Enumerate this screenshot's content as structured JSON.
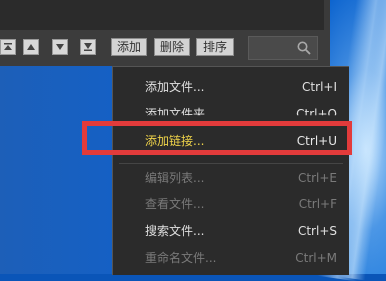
{
  "toolbar": {
    "buttons": [
      {
        "name": "move-top-icon"
      },
      {
        "name": "move-up-icon"
      },
      {
        "name": "move-down-icon"
      },
      {
        "name": "move-bottom-icon"
      }
    ],
    "add_label": "添加",
    "delete_label": "删除",
    "sort_label": "排序",
    "search_icon": "search-icon"
  },
  "menu": {
    "items": [
      {
        "label": "添加文件...",
        "shortcut": "Ctrl+I",
        "state": "enabled"
      },
      {
        "label": "添加文件夹",
        "shortcut": "Ctrl+O",
        "state": "enabled"
      },
      {
        "label": "添加链接...",
        "shortcut": "Ctrl+U",
        "state": "highlighted"
      },
      {
        "label": "编辑列表...",
        "shortcut": "Ctrl+E",
        "state": "disabled"
      },
      {
        "label": "查看文件...",
        "shortcut": "Ctrl+F",
        "state": "disabled"
      },
      {
        "label": "搜索文件...",
        "shortcut": "Ctrl+S",
        "state": "enabled"
      },
      {
        "label": "重命名文件...",
        "shortcut": "Ctrl+M",
        "state": "disabled"
      }
    ]
  },
  "colors": {
    "highlight_border": "#e23b3b",
    "highlight_text": "#f0d44a",
    "menu_bg": "#2b2b2b",
    "desktop_blue": "#0a55b8"
  }
}
